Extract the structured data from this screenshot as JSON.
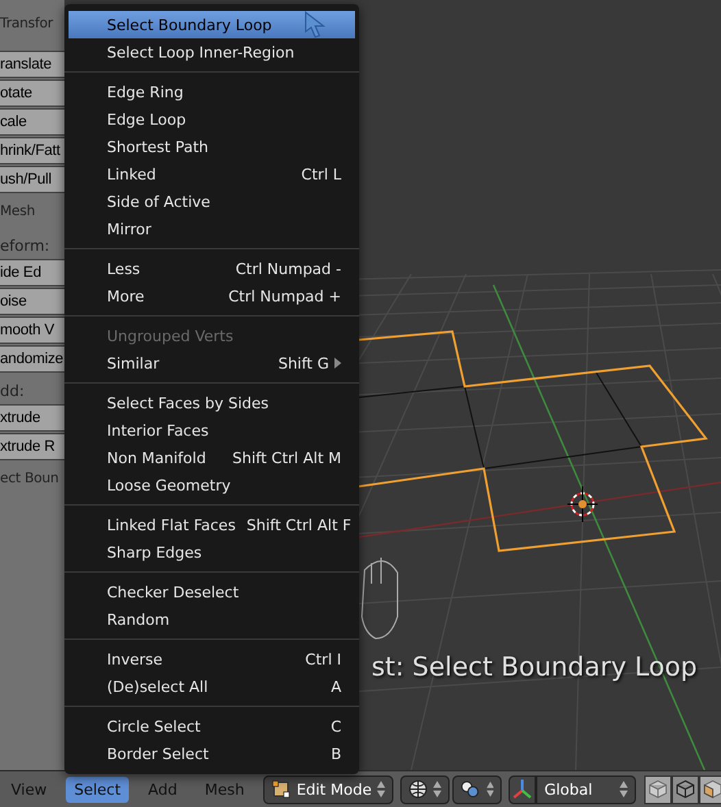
{
  "tool_panel": {
    "items": [
      {
        "kind": "header",
        "text": "Transfor"
      },
      {
        "kind": "button",
        "text": "ranslate"
      },
      {
        "kind": "button",
        "text": "otate"
      },
      {
        "kind": "button",
        "text": "cale"
      },
      {
        "kind": "button",
        "text": "hrink/Fatt"
      },
      {
        "kind": "button",
        "text": "ush/Pull"
      },
      {
        "kind": "header",
        "text": "Mesh"
      },
      {
        "kind": "label",
        "text": "eform:"
      },
      {
        "kind": "button",
        "text": "ide Ed"
      },
      {
        "kind": "button",
        "text": "oise"
      },
      {
        "kind": "button",
        "text": "mooth V"
      },
      {
        "kind": "button",
        "text": "andomize"
      },
      {
        "kind": "label",
        "text": "dd:"
      },
      {
        "kind": "button",
        "text": "xtrude"
      },
      {
        "kind": "button",
        "text": "xtrude R"
      },
      {
        "kind": "header",
        "text": "ect Boun"
      }
    ]
  },
  "select_menu": {
    "sections": [
      [
        {
          "label": "Select Boundary Loop",
          "selected": true,
          "disabled": false,
          "submenu": false
        },
        {
          "label": "Select Loop Inner-Region",
          "selected": false,
          "disabled": false,
          "submenu": false
        }
      ],
      [
        {
          "label": "Edge Ring",
          "selected": false,
          "disabled": false,
          "submenu": false
        },
        {
          "label": "Edge Loop",
          "selected": false,
          "disabled": false,
          "submenu": false
        },
        {
          "label": "Shortest Path",
          "selected": false,
          "disabled": false,
          "submenu": false
        },
        {
          "label": "Linked",
          "shortcut": "Ctrl L",
          "selected": false,
          "disabled": false,
          "submenu": false
        },
        {
          "label": "Side of Active",
          "selected": false,
          "disabled": false,
          "submenu": false
        },
        {
          "label": "Mirror",
          "selected": false,
          "disabled": false,
          "submenu": false
        }
      ],
      [
        {
          "label": "Less",
          "shortcut": "Ctrl Numpad -",
          "selected": false,
          "disabled": false,
          "submenu": false
        },
        {
          "label": "More",
          "shortcut": "Ctrl Numpad +",
          "selected": false,
          "disabled": false,
          "submenu": false
        }
      ],
      [
        {
          "label": "Ungrouped Verts",
          "selected": false,
          "disabled": true,
          "submenu": false
        },
        {
          "label": "Similar",
          "shortcut": "Shift G",
          "selected": false,
          "disabled": false,
          "submenu": true
        }
      ],
      [
        {
          "label": "Select Faces by Sides",
          "selected": false,
          "disabled": false,
          "submenu": false
        },
        {
          "label": "Interior Faces",
          "selected": false,
          "disabled": false,
          "submenu": false
        },
        {
          "label": "Non Manifold",
          "shortcut": "Shift Ctrl Alt M",
          "selected": false,
          "disabled": false,
          "submenu": false
        },
        {
          "label": "Loose Geometry",
          "selected": false,
          "disabled": false,
          "submenu": false
        }
      ],
      [
        {
          "label": "Linked Flat Faces",
          "shortcut": "Shift Ctrl Alt F",
          "selected": false,
          "disabled": false,
          "submenu": false
        },
        {
          "label": "Sharp Edges",
          "selected": false,
          "disabled": false,
          "submenu": false
        }
      ],
      [
        {
          "label": "Checker Deselect",
          "selected": false,
          "disabled": false,
          "submenu": false
        },
        {
          "label": "Random",
          "selected": false,
          "disabled": false,
          "submenu": false
        }
      ],
      [
        {
          "label": "Inverse",
          "shortcut": "Ctrl I",
          "selected": false,
          "disabled": false,
          "submenu": false
        },
        {
          "label": "(De)select All",
          "shortcut": "A",
          "selected": false,
          "disabled": false,
          "submenu": false
        }
      ],
      [
        {
          "label": "Circle Select",
          "shortcut": "C",
          "selected": false,
          "disabled": false,
          "submenu": false
        },
        {
          "label": "Border Select",
          "shortcut": "B",
          "selected": false,
          "disabled": false,
          "submenu": false
        }
      ]
    ]
  },
  "viewport": {
    "last_operator": "st: Select Boundary Loop"
  },
  "header_bar": {
    "menus": [
      {
        "label": "View",
        "selected": false
      },
      {
        "label": "Select",
        "selected": true
      },
      {
        "label": "Add",
        "selected": false
      },
      {
        "label": "Mesh",
        "selected": false
      }
    ],
    "mode": "Edit Mode",
    "orientation": "Global"
  }
}
